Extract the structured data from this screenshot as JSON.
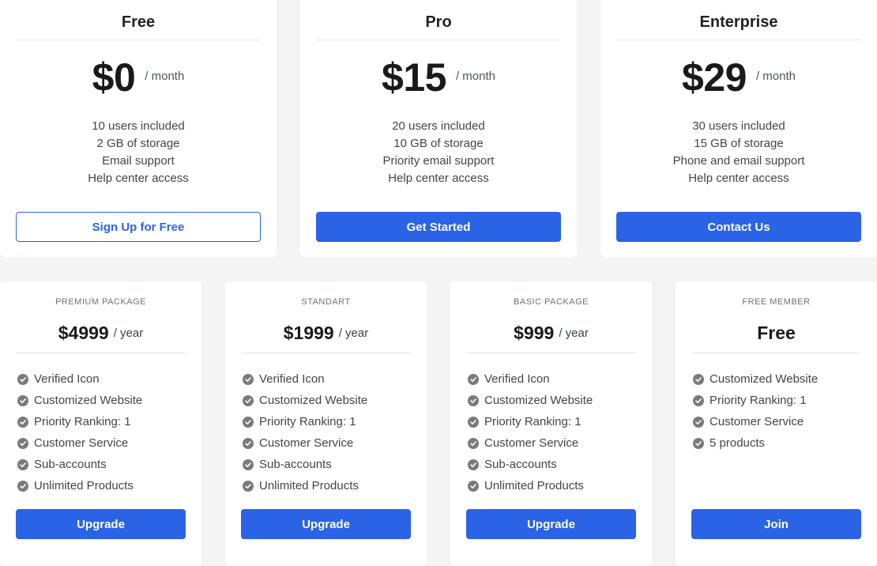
{
  "plans": [
    {
      "title": "Free",
      "price": "$0",
      "period": "/ month",
      "features": [
        "10 users included",
        "2 GB of storage",
        "Email support",
        "Help center access"
      ],
      "button": "Sign Up for Free",
      "button_style": "outline"
    },
    {
      "title": "Pro",
      "price": "$15",
      "period": "/ month",
      "features": [
        "20 users included",
        "10 GB of storage",
        "Priority email support",
        "Help center access"
      ],
      "button": "Get Started",
      "button_style": "primary"
    },
    {
      "title": "Enterprise",
      "price": "$29",
      "period": "/ month",
      "features": [
        "30 users included",
        "15 GB of storage",
        "Phone and email support",
        "Help center access"
      ],
      "button": "Contact Us",
      "button_style": "primary"
    }
  ],
  "packages": [
    {
      "label": "PREMIUM PACKAGE",
      "price": "$4999",
      "period": "/ year",
      "features": [
        "Verified Icon",
        "Customized Website",
        "Priority Ranking: 1",
        "Customer Service",
        "Sub-accounts",
        "Unlimited Products"
      ],
      "button": "Upgrade"
    },
    {
      "label": "STANDART",
      "price": "$1999",
      "period": "/ year",
      "features": [
        "Verified Icon",
        "Customized Website",
        "Priority Ranking: 1",
        "Customer Service",
        "Sub-accounts",
        "Unlimited Products"
      ],
      "button": "Upgrade"
    },
    {
      "label": "BASIC PACKAGE",
      "price": "$999",
      "period": "/ year",
      "features": [
        "Verified Icon",
        "Customized Website",
        "Priority Ranking: 1",
        "Customer Service",
        "Sub-accounts",
        "Unlimited Products"
      ],
      "button": "Upgrade"
    },
    {
      "label": "FREE MEMBER",
      "price": "Free",
      "period": "",
      "features": [
        "Customized Website",
        "Priority Ranking: 1",
        "Customer Service",
        "5 products"
      ],
      "button": "Join"
    }
  ],
  "colors": {
    "accent": "#2b63e6",
    "background": "#f4f4f5",
    "check": "#7a7a7a"
  },
  "icons": {
    "feature": "check-circle-icon"
  }
}
